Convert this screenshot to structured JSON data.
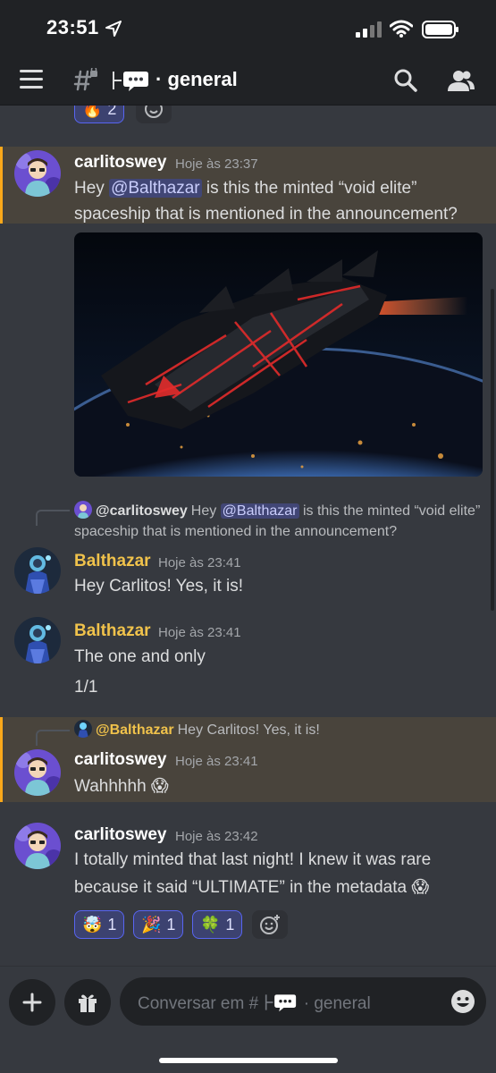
{
  "status_bar": {
    "time": "23:51"
  },
  "header": {
    "channel_name": "· general"
  },
  "top_reactions": [
    {
      "emoji": "🔥",
      "count": "2"
    }
  ],
  "messages": [
    {
      "author": "carlitoswey",
      "timestamp": "Hoje às 23:37",
      "text_prefix": "Hey ",
      "mention": "@Balthazar",
      "text_suffix": " is this the minted “void elite” spaceship that is mentioned in the announcement?",
      "has_image": true
    },
    {
      "reply_to": {
        "author": "@carlitoswey",
        "prefix": "Hey ",
        "mention": "@Balthazar",
        "suffix": " is this the minted “void elite” spaceship that is mentioned in the announcement?"
      },
      "author": "Balthazar",
      "timestamp": "Hoje às 23:41",
      "text": "Hey Carlitos! Yes, it is!"
    },
    {
      "author": "Balthazar",
      "timestamp": "Hoje às 23:41",
      "text": "The one and only",
      "text2": "1/1"
    },
    {
      "reply_to": {
        "author": "@Balthazar",
        "text": "Hey Carlitos! Yes, it is!"
      },
      "author": "carlitoswey",
      "timestamp": "Hoje às 23:41",
      "text": "Wahhhhh 😱"
    },
    {
      "author": "carlitoswey",
      "timestamp": "Hoje às 23:42",
      "text_line1": "I totally minted that last night! I knew it was rare",
      "text_line2": "because it said “ULTIMATE” in the metadata 😱",
      "reactions": [
        {
          "emoji": "🤯",
          "count": "1"
        },
        {
          "emoji": "🎉",
          "count": "1"
        },
        {
          "emoji": "🍀",
          "count": "1"
        }
      ]
    }
  ],
  "composer": {
    "placeholder_prefix": "Conversar em #",
    "placeholder_channel": "· general"
  },
  "colors": {
    "mention_bg": "#414675",
    "highlight_bg": "#49443c",
    "highlight_bar": "#faa81a",
    "balthazar": "#f0c24b"
  }
}
